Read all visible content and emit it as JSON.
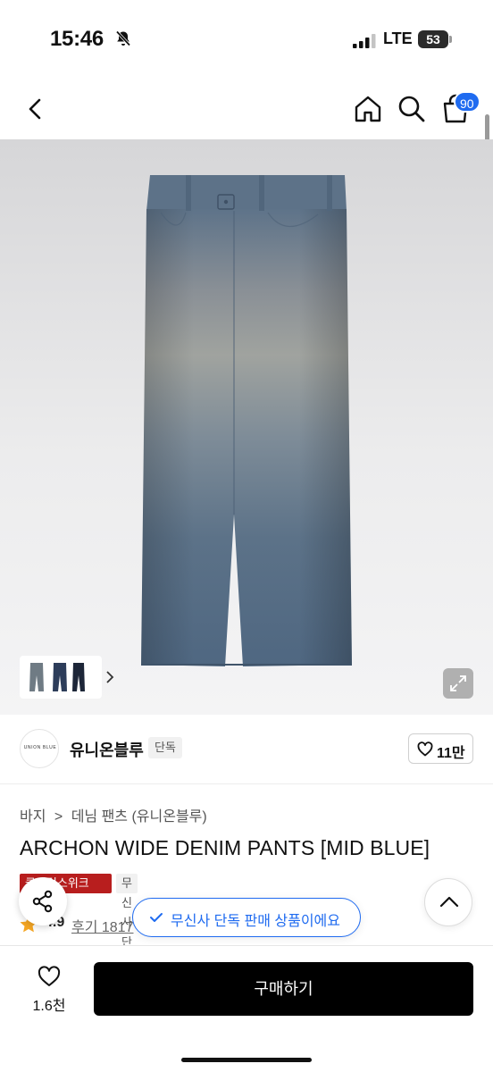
{
  "status_bar": {
    "time": "15:46",
    "network": "LTE",
    "battery": "53"
  },
  "nav": {
    "cart_count": "90",
    "icons": [
      "back-icon",
      "home-icon",
      "search-icon",
      "cart-icon"
    ]
  },
  "hero": {
    "image": "wide denim pants, mid blue, faded",
    "thumbnail_icons": [
      "jeans-thumb-icon",
      "jeans-thumb-icon",
      "jeans-thumb-icon"
    ]
  },
  "brand": {
    "logo_text": "UNION BLUE",
    "name": "유니온블루",
    "exclusive_tag": "단독",
    "like_count": "11만"
  },
  "product": {
    "breadcrumb": [
      "바지",
      "데님 팬츠 (유니온블루)"
    ],
    "breadcrumb_sep": ">",
    "title": "ARCHON WIDE DENIM PANTS [MID BLUE]",
    "tag_event": "클린럭스위크",
    "tag_exclusive": "무신사단독",
    "rating": "4.9",
    "review": "후기 1817"
  },
  "toast": {
    "text": "무신사 단독 판매 상품이에요"
  },
  "bottom": {
    "wish_count": "1.6천",
    "buy_label": "구매하기"
  },
  "colors": {
    "accent_blue": "#1f6bf0",
    "tag_red": "#b81e1e",
    "buy_button": "#000000"
  }
}
